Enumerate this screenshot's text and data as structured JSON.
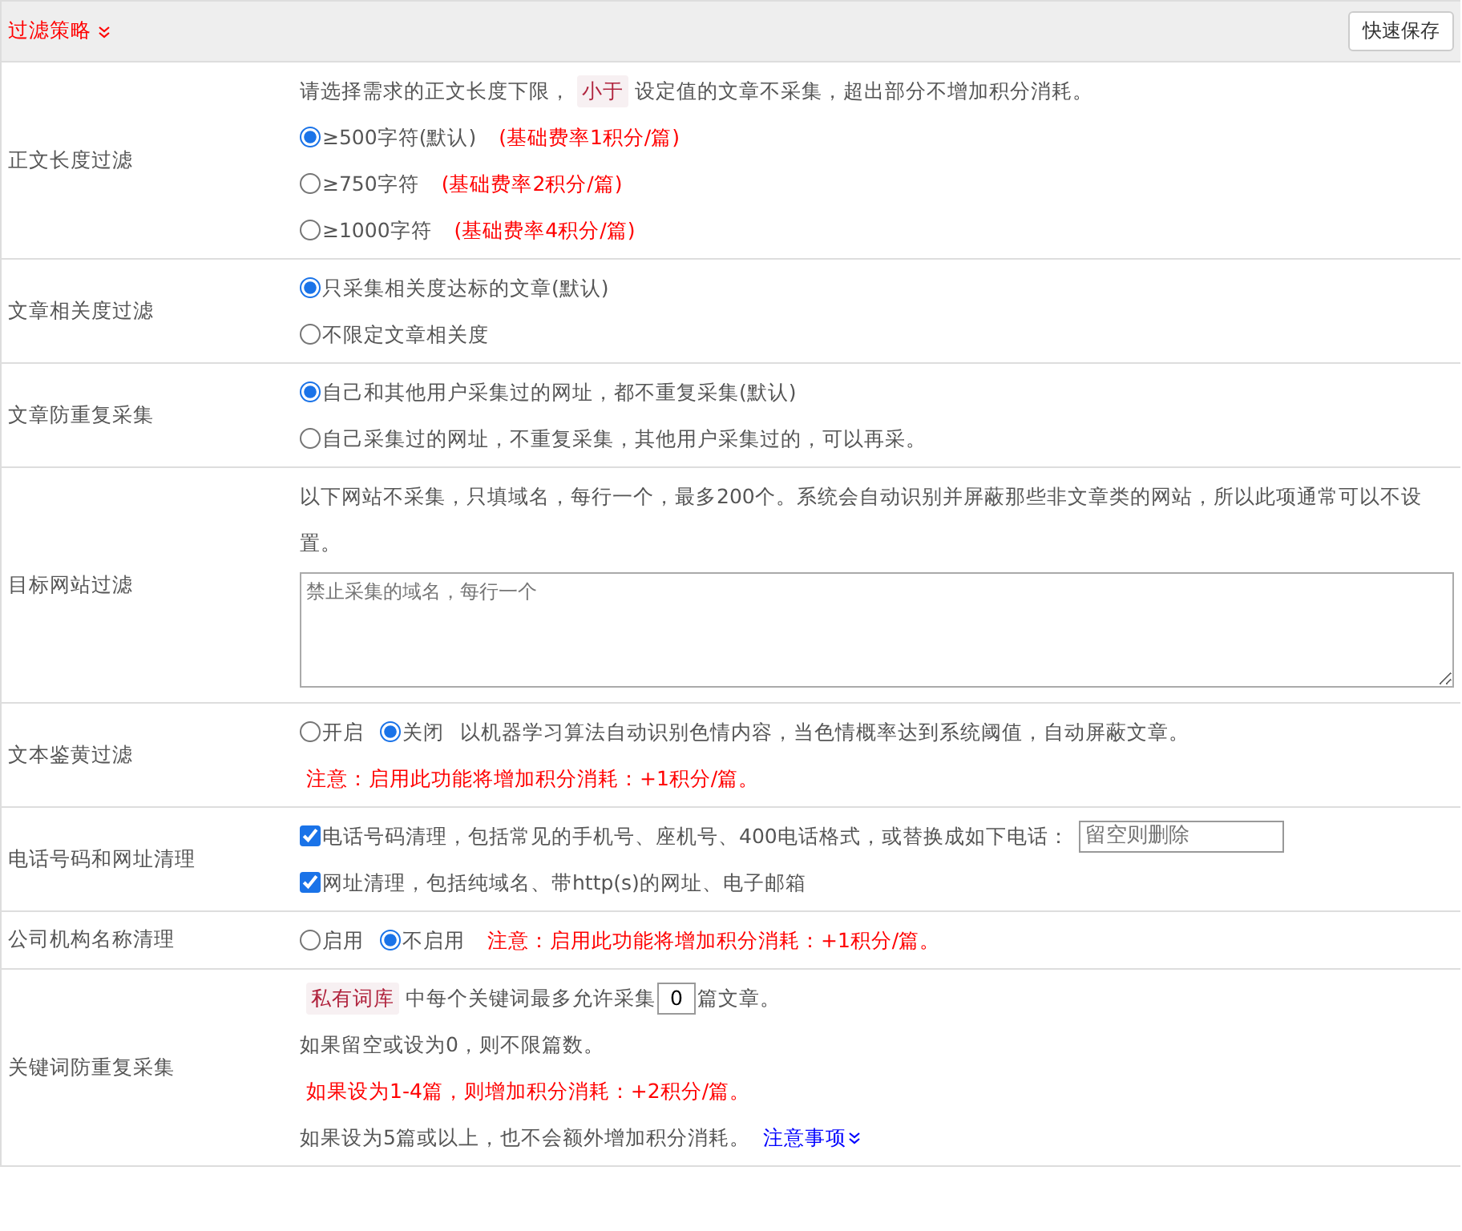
{
  "header": {
    "title": "过滤策略",
    "save_button": "快速保存"
  },
  "rows": [
    {
      "label": "正文长度过滤",
      "lines": [
        {
          "kind": "parts",
          "parts": [
            {
              "kind": "plain",
              "text": "请选择需求的正文长度下限，"
            },
            {
              "kind": "tag",
              "text": "小于"
            },
            {
              "kind": "plain",
              "text": "设定值的文章不采集，超出部分不增加积分消耗。"
            }
          ]
        },
        {
          "kind": "radio",
          "options": [
            {
              "label": "≥500字符(默认)",
              "selected": true
            }
          ],
          "after": {
            "warning": true,
            "text": "(基础费率1积分/篇)"
          }
        },
        {
          "kind": "radio",
          "options": [
            {
              "label": "≥750字符",
              "selected": false
            }
          ],
          "after": {
            "warning": true,
            "text": "(基础费率2积分/篇)"
          }
        },
        {
          "kind": "radio",
          "options": [
            {
              "label": "≥1000字符",
              "selected": false
            }
          ],
          "after": {
            "warning": true,
            "text": "(基础费率4积分/篇)"
          }
        }
      ]
    },
    {
      "label": "文章相关度过滤",
      "lines": [
        {
          "kind": "radio",
          "options": [
            {
              "label": "只采集相关度达标的文章(默认)",
              "selected": true
            }
          ]
        },
        {
          "kind": "radio",
          "options": [
            {
              "label": "不限定文章相关度",
              "selected": false
            }
          ]
        }
      ]
    },
    {
      "label": "文章防重复采集",
      "lines": [
        {
          "kind": "radio",
          "options": [
            {
              "label": "自己和其他用户采集过的网址，都不重复采集(默认)",
              "selected": true
            }
          ]
        },
        {
          "kind": "radio",
          "options": [
            {
              "label": "自己采集过的网址，不重复采集，其他用户采集过的，可以再采。",
              "selected": false
            }
          ]
        }
      ]
    },
    {
      "label": "目标网站过滤",
      "lines": [
        {
          "kind": "parts",
          "parts": [
            {
              "kind": "plain",
              "text": "以下网站不采集，只填域名，每行一个，最多200个。系统会自动识别并屏蔽那些非文章类的网站，所以此项通常可以不设置。"
            }
          ]
        },
        {
          "kind": "textarea",
          "placeholder": "禁止采集的域名，每行一个"
        }
      ]
    },
    {
      "label": "文本鉴黄过滤",
      "lines": [
        {
          "kind": "radio",
          "options": [
            {
              "label": "开启",
              "selected": false
            },
            {
              "label": "关闭",
              "selected": true
            }
          ],
          "after": {
            "warning": false,
            "text": "以机器学习算法自动识别色情内容，当色情概率达到系统阈值，自动屏蔽文章。"
          }
        },
        {
          "kind": "parts",
          "parts": [
            {
              "kind": "red",
              "text": "注意：启用此功能将增加积分消耗：+1积分/篇。"
            }
          ]
        }
      ]
    },
    {
      "label": "电话号码和网址清理",
      "lines": [
        {
          "kind": "checkbox",
          "text": "电话号码清理，包括常见的手机号、座机号、400电话格式，或替换成如下电话：",
          "checked": true,
          "field_placeholder": "留空则删除"
        },
        {
          "kind": "checkbox",
          "text": "网址清理，包括纯域名、带http(s)的网址、电子邮箱",
          "checked": true
        }
      ]
    },
    {
      "label": "公司机构名称清理",
      "lines": [
        {
          "kind": "radio",
          "options": [
            {
              "label": "启用",
              "selected": false
            },
            {
              "label": "不启用",
              "selected": true
            }
          ],
          "after": {
            "warning": true,
            "text": "注意：启用此功能将增加积分消耗：+1积分/篇。"
          }
        }
      ]
    },
    {
      "label": "关键词防重复采集",
      "lines": [
        {
          "kind": "parts",
          "parts": [
            {
              "kind": "tag",
              "text": "私有词库"
            },
            {
              "kind": "plain",
              "text": "中每个关键词最多允许采集"
            },
            {
              "kind": "field",
              "text": "0"
            },
            {
              "kind": "plain",
              "text": "篇文章。"
            }
          ]
        },
        {
          "kind": "parts",
          "parts": [
            {
              "kind": "plain",
              "text": "如果留空或设为0，则不限篇数。"
            }
          ]
        },
        {
          "kind": "parts",
          "parts": [
            {
              "kind": "red",
              "text": "如果设为1-4篇，则增加积分消耗：+2积分/篇。"
            }
          ]
        },
        {
          "kind": "parts",
          "parts": [
            {
              "kind": "plain",
              "text": "如果设为5篇或以上，也不会额外增加积分消耗。"
            },
            {
              "kind": "link",
              "text": "注意事项"
            }
          ]
        }
      ]
    }
  ]
}
